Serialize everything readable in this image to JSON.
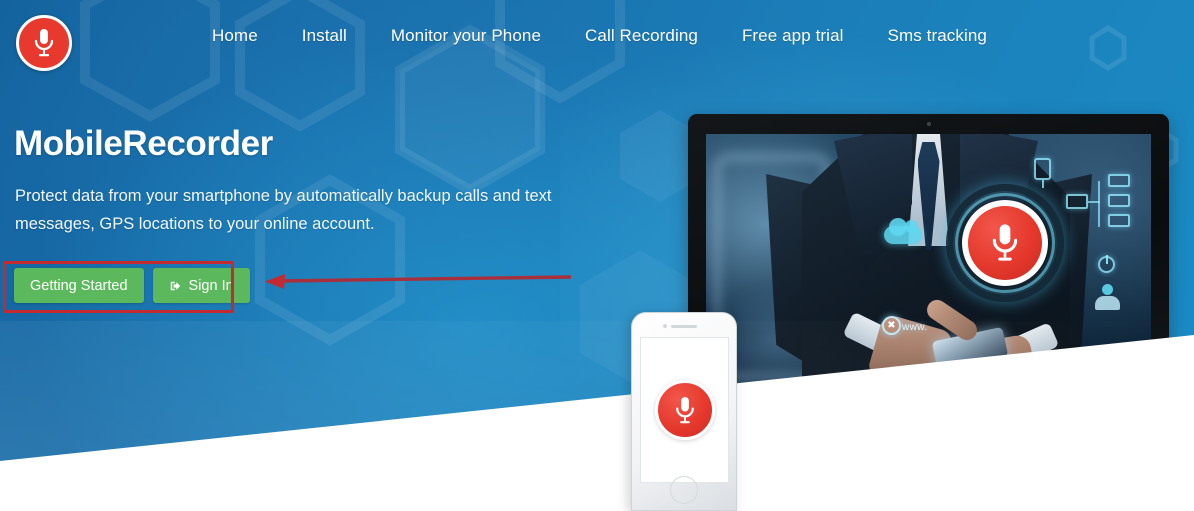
{
  "brand": {
    "logo_icon": "microphone-icon",
    "name": "MobileRecorder"
  },
  "nav": {
    "items": [
      {
        "label": "Home"
      },
      {
        "label": "Install"
      },
      {
        "label": "Monitor your Phone"
      },
      {
        "label": "Call Recording"
      },
      {
        "label": "Free app trial"
      },
      {
        "label": "Sms tracking"
      }
    ]
  },
  "hero": {
    "title": "MobileRecorder",
    "description": "Protect data from your smartphone by automatically backup calls and text messages, GPS locations to your online account.",
    "buttons": [
      {
        "label": "Getting Started",
        "icon": "none"
      },
      {
        "label": "Sign In",
        "icon": "sign-in-icon"
      }
    ]
  },
  "annotation": {
    "highlight_shape": "rectangle",
    "arrow_direction": "left",
    "color": "#c42b30"
  },
  "artwork": {
    "monitor_scene": "businessman-touching-microphone-hologram",
    "hologram_icon": "microphone-icon",
    "floating_icons": [
      "tablet-icon",
      "cloud-icon",
      "network-diagram-icon",
      "power-icon",
      "user-icon",
      "www-icon"
    ],
    "www_label": "www.",
    "phone_screen_icon": "microphone-icon"
  },
  "colors": {
    "brand_red": "#e5382c",
    "button_green": "#5cb85c",
    "hero_blue_dark": "#14639f",
    "hero_blue_light": "#1b8cc6",
    "annotation_red": "#c42b30"
  }
}
